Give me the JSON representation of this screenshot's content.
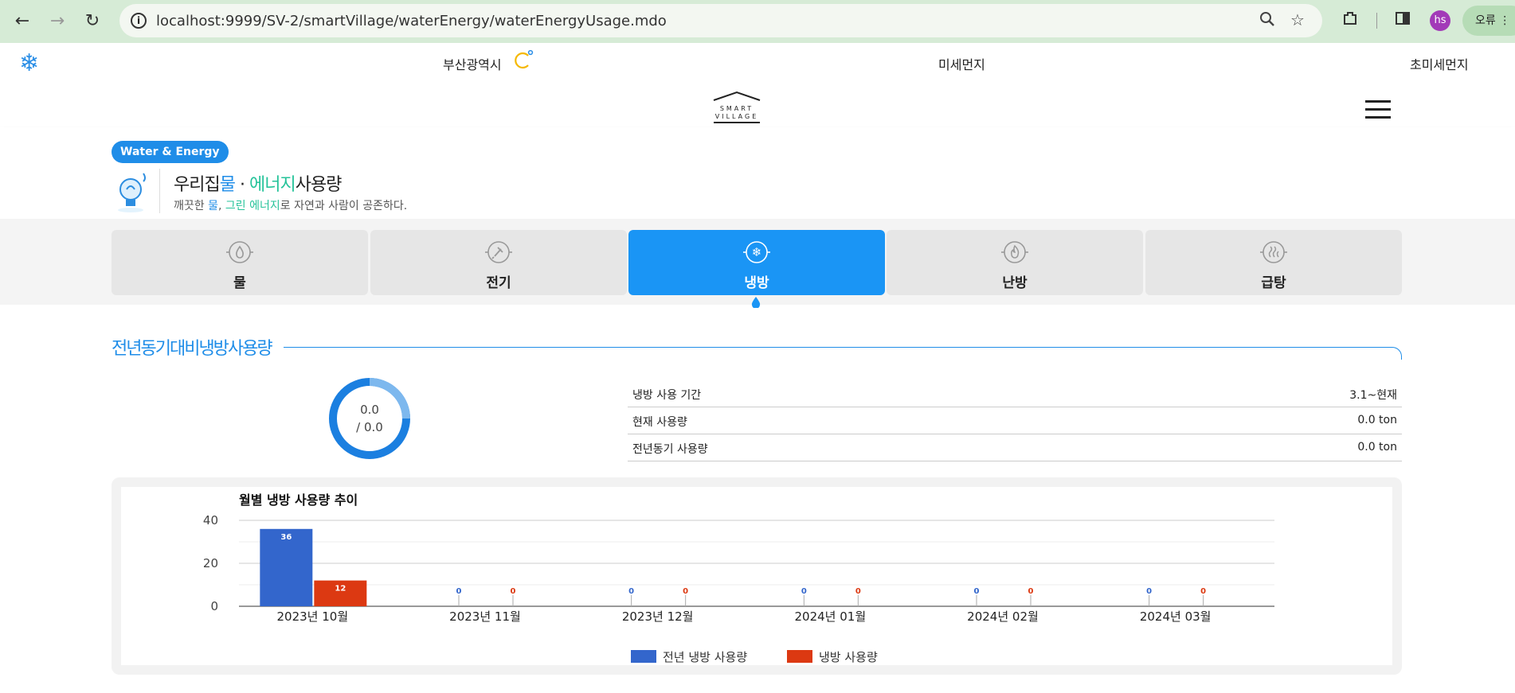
{
  "browser": {
    "url": "localhost:9999/SV-2/smartVillage/waterEnergy/waterEnergyUsage.mdo",
    "profile_initials": "hs",
    "error_label": "오류"
  },
  "header": {
    "city": "부산광역시",
    "dust_label": "미세먼지",
    "fine_dust_label": "초미세먼지",
    "brand_small": "SMART VILLAGE"
  },
  "page": {
    "badge": "Water & Energy",
    "title_prefix": "우리집",
    "title_water": "물",
    "title_dot": " · ",
    "title_energy": "에너지",
    "title_suffix": "사용량",
    "sub_prefix": "깨끗한 ",
    "sub_water": "물",
    "sub_comma": ", ",
    "sub_energy": "그린 에너지",
    "sub_suffix": "로 자연과 사람이 공존하다."
  },
  "tabs": [
    {
      "label": "물",
      "icon": "water-drop-icon",
      "active": false
    },
    {
      "label": "전기",
      "icon": "electric-plug-icon",
      "active": false
    },
    {
      "label": "냉방",
      "icon": "snowflake-icon",
      "active": true
    },
    {
      "label": "난방",
      "icon": "flame-icon",
      "active": false
    },
    {
      "label": "급탕",
      "icon": "hot-water-icon",
      "active": false
    }
  ],
  "section": {
    "title": "전년동기대비냉방사용량",
    "donut_current": "0.0",
    "donut_prev": "/ 0.0",
    "rows": [
      {
        "label": "냉방 사용 기간",
        "value": "3.1~현재"
      },
      {
        "label": "현재 사용량",
        "value": "0.0 ton"
      },
      {
        "label": "전년동기 사용량",
        "value": "0.0 ton"
      }
    ]
  },
  "colors": {
    "accent": "#1f8de8",
    "tab_active": "#1a95f5",
    "series_prev": "#3366cc",
    "series_curr": "#dc3912"
  },
  "chart_data": {
    "type": "bar",
    "title": "월별 냉방 사용량 추이",
    "categories": [
      "2023년 10월",
      "2023년 11월",
      "2023년 12월",
      "2024년 01월",
      "2024년 02월",
      "2024년 03월"
    ],
    "series": [
      {
        "name": "전년 냉방 사용량",
        "values": [
          36,
          0,
          0,
          0,
          0,
          0
        ]
      },
      {
        "name": "냉방 사용량",
        "values": [
          12,
          0,
          0,
          0,
          0,
          0
        ]
      }
    ],
    "y_ticks": [
      0,
      20,
      40
    ],
    "ylim": [
      0,
      40
    ],
    "legend_position": "bottom",
    "grid": true
  }
}
